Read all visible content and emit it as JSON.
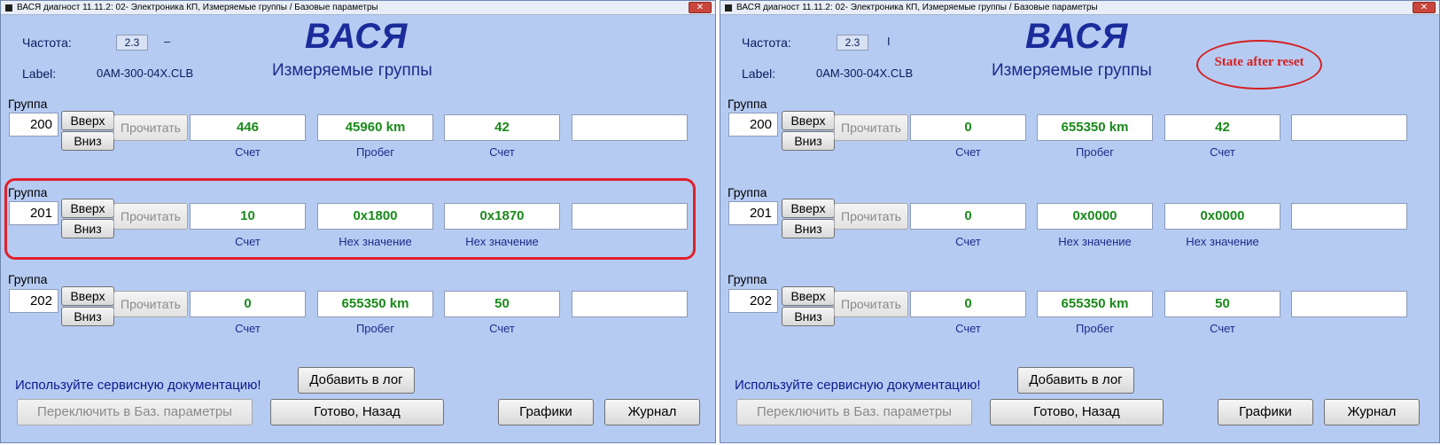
{
  "left": {
    "title": "ВАСЯ диагност 11.11.2: 02- Электроника КП,  Измеряемые группы / Базовые параметры",
    "freq_label": "Частота:",
    "freq_value": "2.3",
    "freq_indicator": "–",
    "label_label": "Label:",
    "label_value": "0AM-300-04X.CLB",
    "logo": "ВАСЯ",
    "subtitle": "Измеряемые группы",
    "groups": [
      {
        "label": "Группа",
        "number": "200",
        "up": "Вверх",
        "down": "Вниз",
        "read": "Прочитать",
        "values": [
          "446",
          "45960 km",
          "42",
          ""
        ],
        "units": [
          "Счет",
          "Пробег",
          "Счет",
          ""
        ]
      },
      {
        "label": "Группа",
        "number": "201",
        "up": "Вверх",
        "down": "Вниз",
        "read": "Прочитать",
        "values": [
          "10",
          "0x1800",
          "0x1870",
          ""
        ],
        "units": [
          "Счет",
          "Hex значение",
          "Hex значение",
          ""
        ]
      },
      {
        "label": "Группа",
        "number": "202",
        "up": "Вверх",
        "down": "Вниз",
        "read": "Прочитать",
        "values": [
          "0",
          "655350 km",
          "50",
          ""
        ],
        "units": [
          "Счет",
          "Пробег",
          "Счет",
          ""
        ]
      }
    ],
    "warning": "Используйте сервисную документацию!",
    "add_log": "Добавить в лог",
    "switch_basic": "Переключить в Баз. параметры",
    "done_back": "Готово, Назад",
    "graphs": "Графики",
    "journal": "Журнал"
  },
  "right": {
    "title": "ВАСЯ диагност 11.11.2: 02- Электроника КП,  Измеряемые группы / Базовые параметры",
    "freq_label": "Частота:",
    "freq_value": "2.3",
    "freq_indicator": "I",
    "label_label": "Label:",
    "label_value": "0AM-300-04X.CLB",
    "logo": "ВАСЯ",
    "subtitle": "Измеряемые группы",
    "annotation": "State after reset",
    "groups": [
      {
        "label": "Группа",
        "number": "200",
        "up": "Вверх",
        "down": "Вниз",
        "read": "Прочитать",
        "values": [
          "0",
          "655350 km",
          "42",
          ""
        ],
        "units": [
          "Счет",
          "Пробег",
          "Счет",
          ""
        ]
      },
      {
        "label": "Группа",
        "number": "201",
        "up": "Вверх",
        "down": "Вниз",
        "read": "Прочитать",
        "values": [
          "0",
          "0x0000",
          "0x0000",
          ""
        ],
        "units": [
          "Счет",
          "Hex значение",
          "Hex значение",
          ""
        ]
      },
      {
        "label": "Группа",
        "number": "202",
        "up": "Вверх",
        "down": "Вниз",
        "read": "Прочитать",
        "values": [
          "0",
          "655350 km",
          "50",
          ""
        ],
        "units": [
          "Счет",
          "Пробег",
          "Счет",
          ""
        ]
      }
    ],
    "warning": "Используйте сервисную документацию!",
    "add_log": "Добавить в лог",
    "switch_basic": "Переключить в Баз. параметры",
    "done_back": "Готово, Назад",
    "graphs": "Графики",
    "journal": "Журнал"
  },
  "colors": {
    "window_bg": "#b6cbf2",
    "value_text": "#1a8a1a",
    "logo_text": "#1a2b9a",
    "highlight_red": "#e0202a"
  }
}
